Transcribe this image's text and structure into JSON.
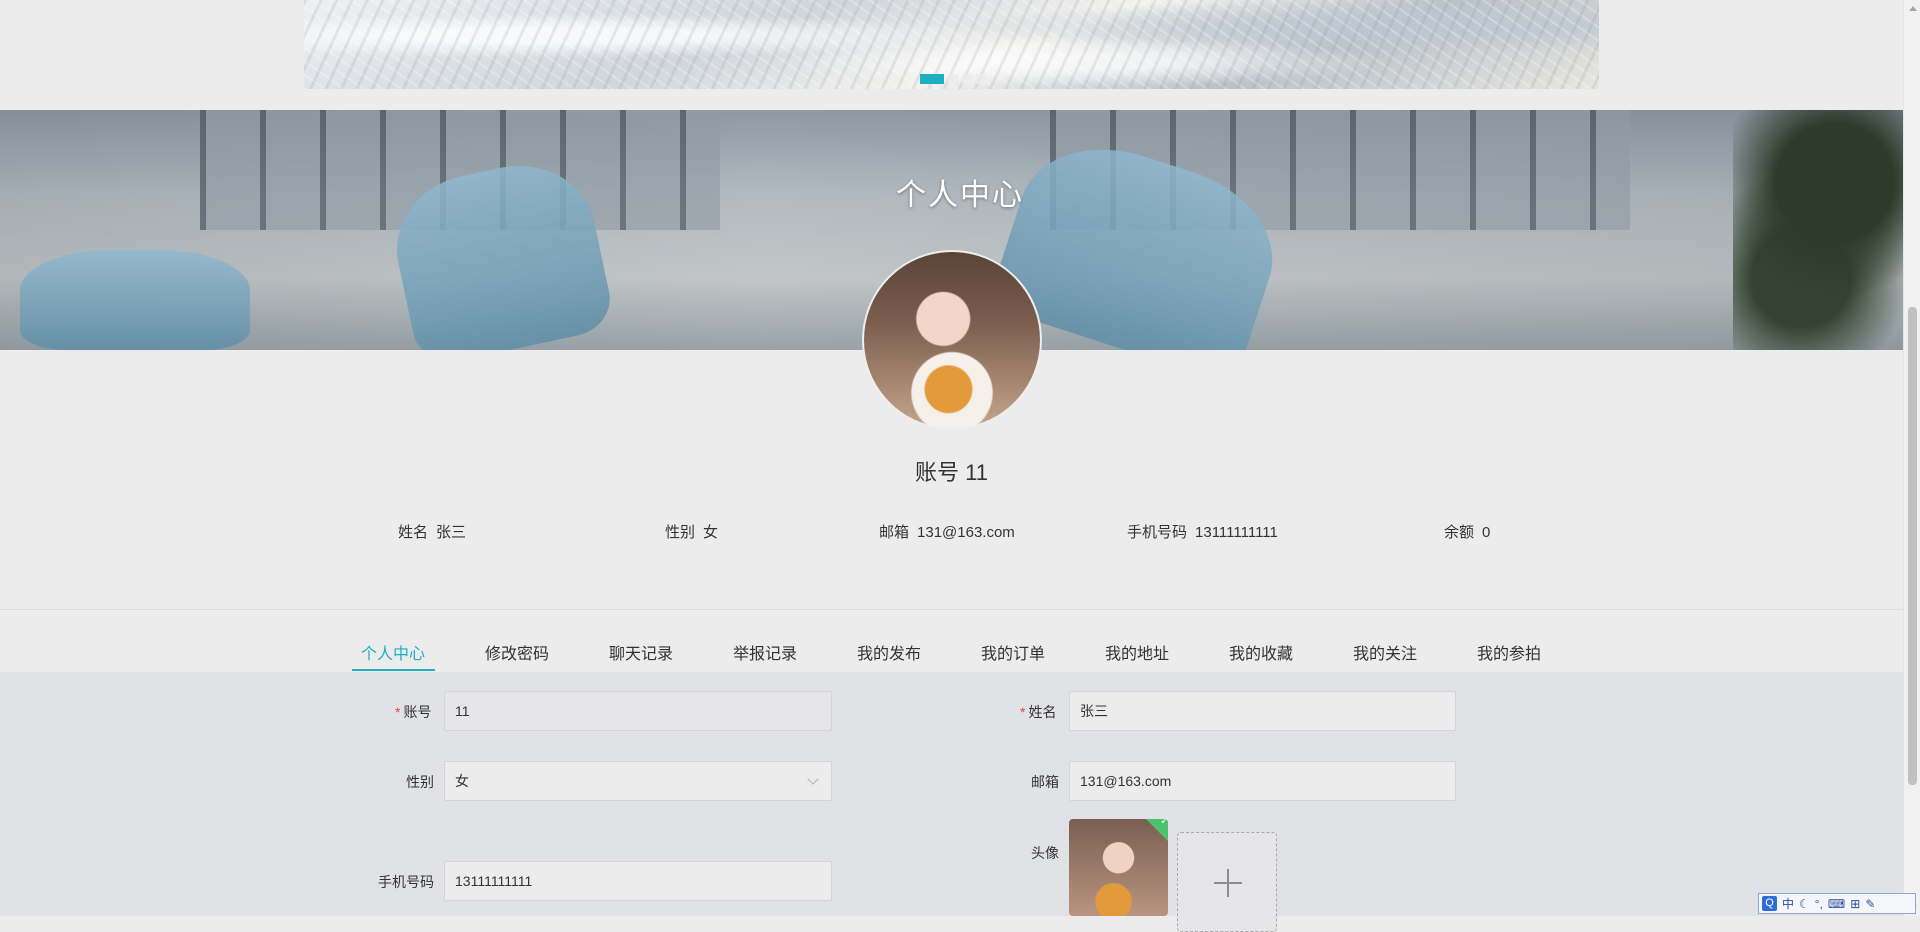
{
  "carousel": {
    "dots": 4,
    "active_index": 0
  },
  "hero": {
    "title": "个人中心"
  },
  "profile": {
    "account_title": "账号 11",
    "info": [
      {
        "label": "姓名",
        "value": "张三"
      },
      {
        "label": "性别",
        "value": "女"
      },
      {
        "label": "邮箱",
        "value": "131@163.com"
      },
      {
        "label": "手机号码",
        "value": "13111111111"
      },
      {
        "label": "余额",
        "value": "0"
      }
    ]
  },
  "tabs": [
    {
      "label": "个人中心",
      "active": true
    },
    {
      "label": "修改密码",
      "active": false
    },
    {
      "label": "聊天记录",
      "active": false
    },
    {
      "label": "举报记录",
      "active": false
    },
    {
      "label": "我的发布",
      "active": false
    },
    {
      "label": "我的订单",
      "active": false
    },
    {
      "label": "我的地址",
      "active": false
    },
    {
      "label": "我的收藏",
      "active": false
    },
    {
      "label": "我的关注",
      "active": false
    },
    {
      "label": "我的参拍",
      "active": false
    }
  ],
  "form": {
    "account": {
      "label": "账号",
      "value": "11",
      "required": true
    },
    "name": {
      "label": "姓名",
      "value": "张三",
      "required": true
    },
    "gender": {
      "label": "性别",
      "value": "女"
    },
    "email": {
      "label": "邮箱",
      "value": "131@163.com"
    },
    "avatar": {
      "label": "头像"
    },
    "phone": {
      "label": "手机号码",
      "value": "13111111111"
    }
  },
  "ime": {
    "logo": "Q",
    "mode": "中",
    "items": [
      "☾",
      "°,",
      "⌨",
      "⊞",
      "✎"
    ]
  },
  "colors": {
    "accent": "#1eb0c0",
    "required": "#e2473c",
    "upload_ok": "#4cc36b"
  }
}
